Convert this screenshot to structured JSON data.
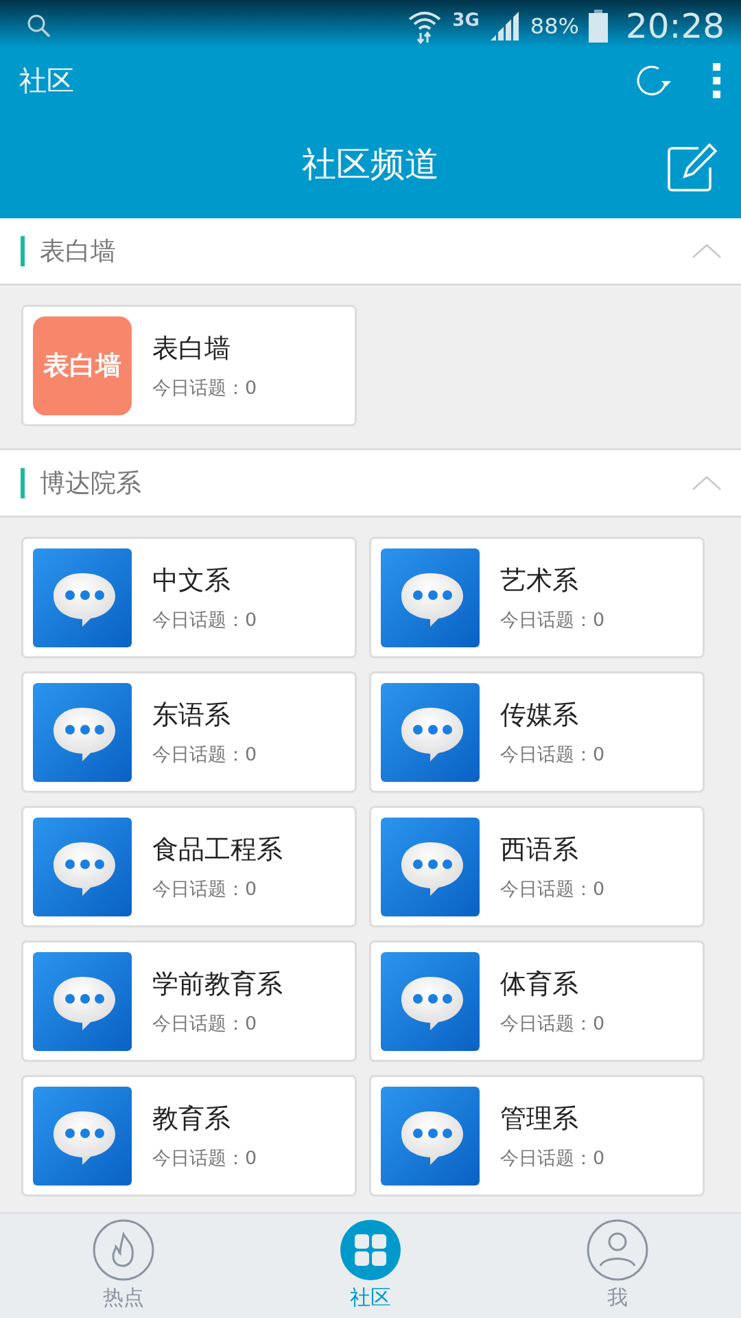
{
  "status_bar": {
    "network": "3G",
    "battery": "88%",
    "time": "20:28"
  },
  "app_bar": {
    "title": "社区"
  },
  "header": {
    "title": "社区频道"
  },
  "sections": [
    {
      "title": "表白墙",
      "expanded": true,
      "channels": [
        {
          "kind": "logo",
          "logo_text": "表白墙",
          "name": "表白墙",
          "topics": "今日话题：0"
        }
      ]
    },
    {
      "title": "博达院系",
      "expanded": true,
      "channels": [
        {
          "kind": "chat",
          "name": "中文系",
          "topics": "今日话题：0"
        },
        {
          "kind": "chat",
          "name": "艺术系",
          "topics": "今日话题：0"
        },
        {
          "kind": "chat",
          "name": "东语系",
          "topics": "今日话题：0"
        },
        {
          "kind": "chat",
          "name": "传媒系",
          "topics": "今日话题：0"
        },
        {
          "kind": "chat",
          "name": "食品工程系",
          "topics": "今日话题：0"
        },
        {
          "kind": "chat",
          "name": "西语系",
          "topics": "今日话题：0"
        },
        {
          "kind": "chat",
          "name": "学前教育系",
          "topics": "今日话题：0"
        },
        {
          "kind": "chat",
          "name": "体育系",
          "topics": "今日话题：0"
        },
        {
          "kind": "chat",
          "name": "教育系",
          "topics": "今日话题：0"
        },
        {
          "kind": "chat",
          "name": "管理系",
          "topics": "今日话题：0"
        }
      ]
    }
  ],
  "bottom_nav": [
    {
      "kind": "hot",
      "label": "热点",
      "selected": false
    },
    {
      "kind": "community",
      "label": "社区",
      "selected": true
    },
    {
      "kind": "me",
      "label": "我",
      "selected": false
    }
  ]
}
